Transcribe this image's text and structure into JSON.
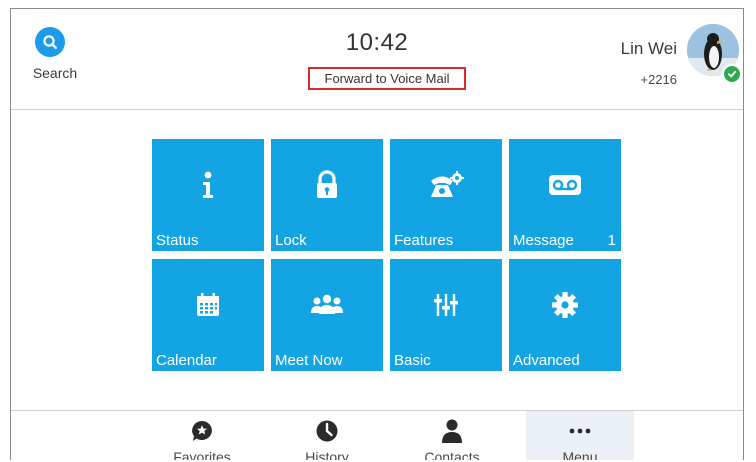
{
  "header": {
    "search_label": "Search",
    "time": "10:42",
    "forward_status": "Forward to Voice Mail",
    "user_name": "Lin Wei",
    "extension": "+2216"
  },
  "tiles": [
    {
      "label": "Status",
      "icon": "info-icon",
      "badge": ""
    },
    {
      "label": "Lock",
      "icon": "lock-icon",
      "badge": ""
    },
    {
      "label": "Features",
      "icon": "phone-gear-icon",
      "badge": ""
    },
    {
      "label": "Message",
      "icon": "voicemail-icon",
      "badge": "1"
    },
    {
      "label": "Calendar",
      "icon": "calendar-icon",
      "badge": ""
    },
    {
      "label": "Meet Now",
      "icon": "people-icon",
      "badge": ""
    },
    {
      "label": "Basic",
      "icon": "sliders-icon",
      "badge": ""
    },
    {
      "label": "Advanced",
      "icon": "gear-icon",
      "badge": ""
    }
  ],
  "nav": [
    {
      "label": "Favorites",
      "icon": "star-bubble-icon",
      "active": false
    },
    {
      "label": "History",
      "icon": "clock-icon",
      "active": false
    },
    {
      "label": "Contacts",
      "icon": "person-icon",
      "active": false
    },
    {
      "label": "Menu",
      "icon": "more-icon",
      "active": true
    }
  ],
  "colors": {
    "tile": "#13a4e4",
    "accent": "#1b9be8",
    "highlight_border": "#d62b2b",
    "presence": "#2fa84f"
  }
}
